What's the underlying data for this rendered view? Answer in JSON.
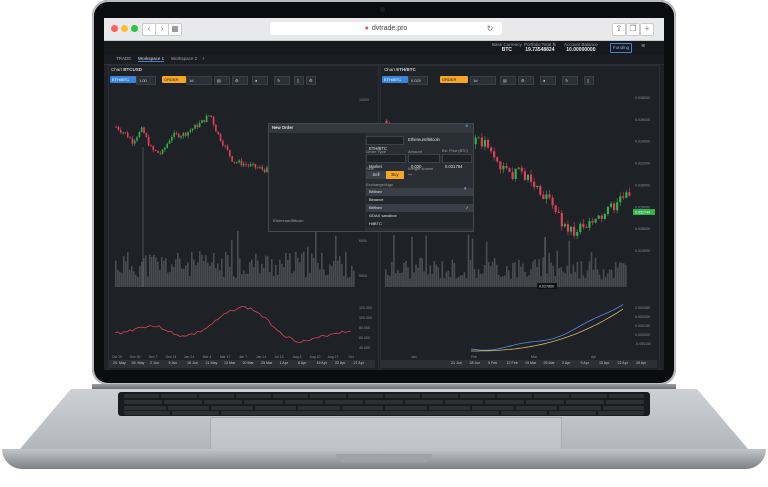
{
  "browser": {
    "url": "dvtrade.pro"
  },
  "header": {
    "stats": [
      {
        "label": "Base Currency",
        "value": "BTC"
      },
      {
        "label": "Portfolio Total ₿",
        "value": "19.73548824"
      },
      {
        "label": "Account Balance",
        "value": "10.00000000"
      }
    ],
    "funding_label": "Funding"
  },
  "tabs": [
    "TRADE",
    "Workspace 1",
    "Workspace 2",
    "+"
  ],
  "left_chart": {
    "title_prefix": "Chart",
    "title": "BTCUSD",
    "symbol": "ETH/BTC",
    "amount": "1.00",
    "interval": "1d",
    "order_button": "ORDER",
    "x_labels": [
      "Oct 20",
      "Nov 30",
      "Dec 7",
      "Dec 14",
      "Jan 24",
      "Mar 4",
      "Mar 17",
      "Jan 7",
      "Jan 14",
      "Jul 13",
      "Aug 3",
      "Aug 10",
      "Aug 17",
      "Oct"
    ],
    "y_labels": [
      "10000",
      "9000",
      "8000",
      "7000",
      "6000",
      "5000"
    ],
    "osc_y_labels": [
      "120.000",
      "100.000",
      "80.000",
      "60.000",
      "40.000"
    ],
    "timeline_labels": [
      "20. May",
      "26. May",
      "2 Jun",
      "9 Jun",
      "16 Jun",
      "21 May",
      "13 Mar",
      "20 Mar",
      "25 Mar",
      "1 Apr",
      "8 Apr",
      "15 Apr",
      "22 Apr",
      "27 Apr"
    ]
  },
  "right_chart": {
    "title_prefix": "Chart",
    "title": "ETH/BTC",
    "symbol": "ETH/BTC",
    "amount": "0.020",
    "interval": "1d",
    "order_button": "ORDER",
    "y_labels": [
      "0.038000",
      "0.036000",
      "0.034000",
      "0.032000",
      "0.030000",
      "0.028000",
      "0.026000",
      "0.024000"
    ],
    "last_price": "0.031744",
    "cursor_price": "0.027850",
    "osc_y_labels": [
      "0.000450",
      "0.000300",
      "0.000150",
      "0.000000",
      "-0.000150"
    ],
    "x_labels": [
      "Jan",
      "Feb",
      "Mar",
      "Apr"
    ],
    "timeline_labels": [
      "21 Jun",
      "28 Jun",
      "5 Feb",
      "12 Feb",
      "19 Mar",
      "26 Mar",
      "2 Apr",
      "9 Apr",
      "15 Apr",
      "22 Apr",
      "29 Apr"
    ]
  },
  "new_order": {
    "title": "New Order",
    "pair": "ETH/BTC",
    "pair_name": "Ethereum/Bitcoin",
    "order_type_label": "Order Type",
    "order_type": "Market",
    "side_label": "Side",
    "amount_label": "Amount",
    "amount": "0.020",
    "price_label": "Est. Price (BTC)",
    "price": "0.031764",
    "sell_label": "Sell",
    "buy_label": "Buy",
    "weight_label": "Weight shown",
    "exchange_label": "Exchange/Algo",
    "exchanges": [
      "Bitfinex",
      "Binance",
      "Bitfinex",
      "GDAX sandbox",
      "HitBTC"
    ],
    "chart_caption": "Ethereum/Bitcoin"
  },
  "colors": {
    "up": "#2fb34a",
    "down": "#e0405a",
    "accent": "#f5a623",
    "blue": "#3a84d8"
  }
}
